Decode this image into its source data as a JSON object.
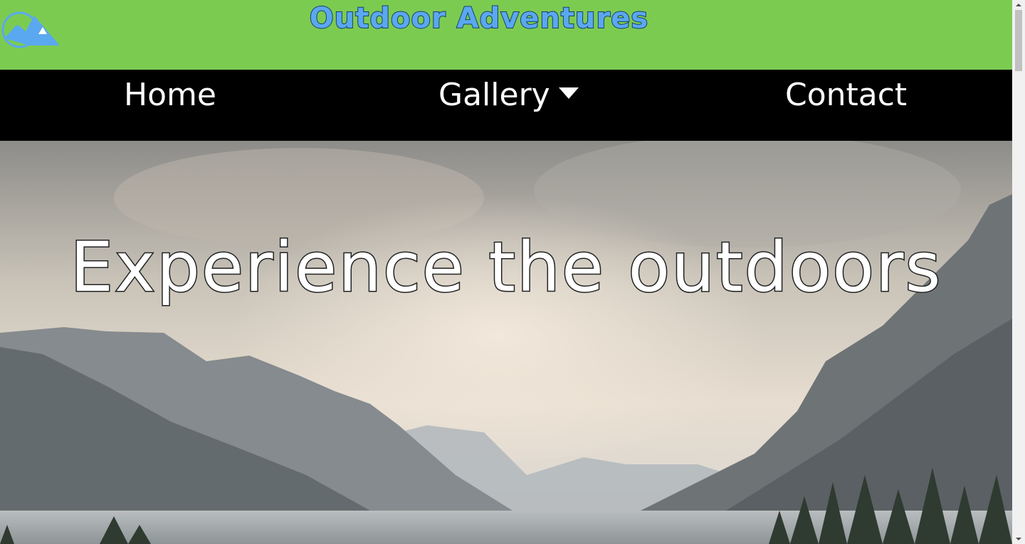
{
  "header": {
    "title": "Outdoor Adventures",
    "background_color": "#7ccb51",
    "title_color": "#5aa8f0",
    "logo_icon": "mountain-tent-icon"
  },
  "nav": {
    "background_color": "#000000",
    "items": [
      {
        "label": "Home"
      },
      {
        "label": "Gallery",
        "icon": "caret-down-icon"
      },
      {
        "label": "Contact"
      }
    ]
  },
  "hero": {
    "heading": "Experience the outdoors",
    "image": "misty-mountain-lake-landscape"
  }
}
